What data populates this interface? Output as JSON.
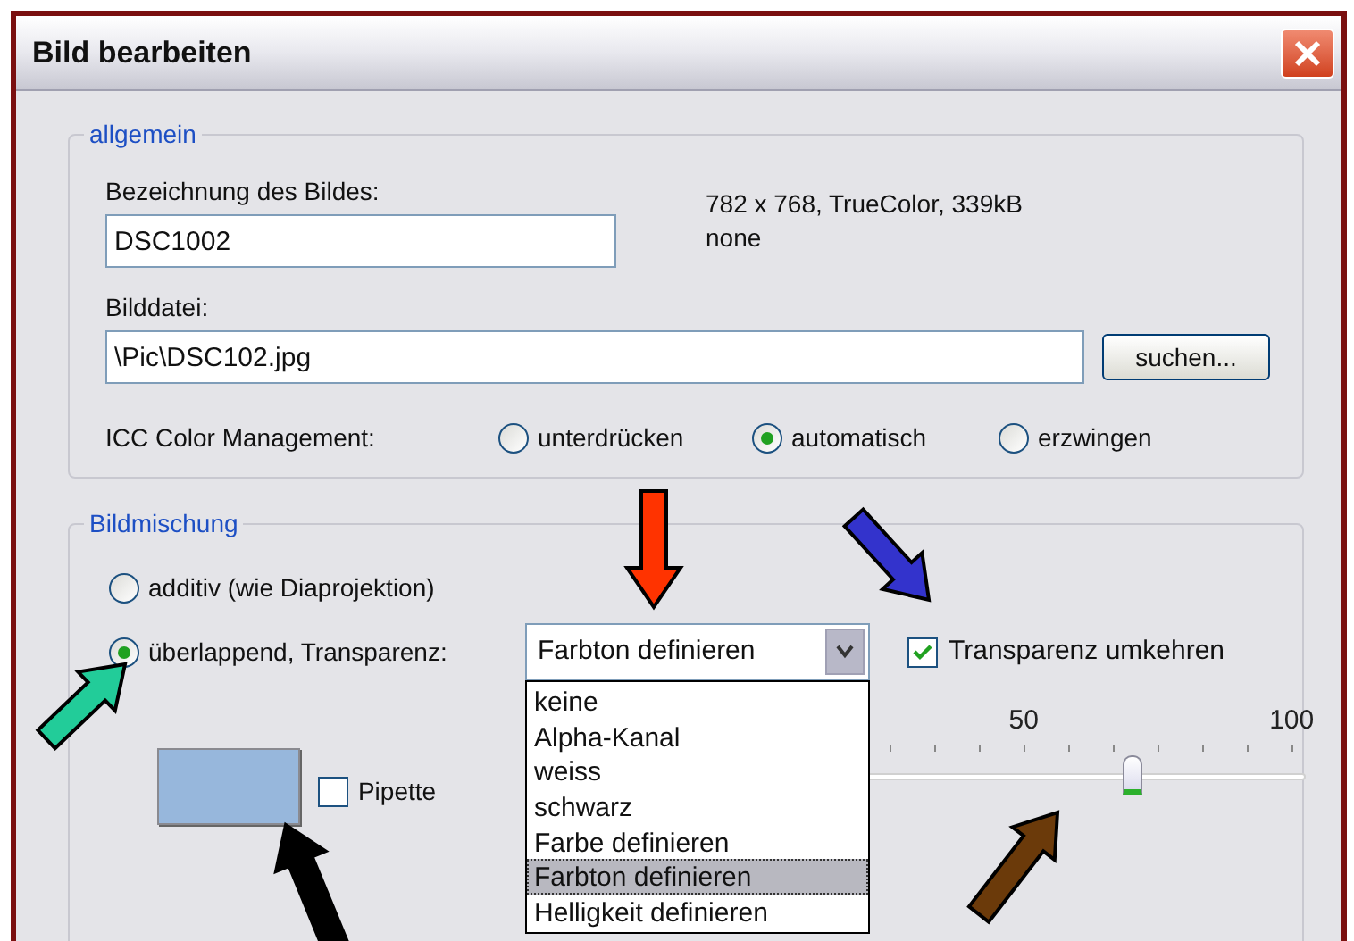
{
  "window": {
    "title": "Bild bearbeiten"
  },
  "general": {
    "legend": "allgemein",
    "name_label": "Bezeichnung des Bildes:",
    "name_value": "DSC1002",
    "info": [
      "782 x 768, TrueColor, 339kB",
      "none"
    ],
    "file_label": "Bilddatei:",
    "file_value": "\\Pic\\DSC102.jpg",
    "browse_button": "suchen...",
    "icc_label": "ICC Color Management:",
    "icc_options": [
      {
        "label": "unterdrücken",
        "selected": false
      },
      {
        "label": "automatisch",
        "selected": true
      },
      {
        "label": "erzwingen",
        "selected": false
      }
    ]
  },
  "blending": {
    "legend": "Bildmischung",
    "modes": [
      {
        "label": "additiv (wie Diaprojektion)",
        "selected": false
      },
      {
        "label": "überlappend, Transparenz:",
        "selected": true
      }
    ],
    "transparency_combo": {
      "value": "Farbton definieren",
      "expanded": true,
      "options": [
        {
          "label": "keine",
          "selected": false
        },
        {
          "label": "Alpha-Kanal",
          "selected": false
        },
        {
          "label": "weiss",
          "selected": false
        },
        {
          "label": "schwarz",
          "selected": false
        },
        {
          "label": "Farbe definieren",
          "selected": false
        },
        {
          "label": "Farbton definieren",
          "selected": true
        },
        {
          "label": "Helligkeit definieren",
          "selected": false
        }
      ]
    },
    "invert_checkbox": {
      "label": "Transparenz umkehren",
      "checked": true
    },
    "color_swatch": {
      "color": "#97b7dc"
    },
    "pipette_checkbox": {
      "label": "Pipette",
      "checked": false
    },
    "slider": {
      "tick_labels": [
        "50",
        "100"
      ],
      "level": 0.7
    }
  },
  "annotation_arrows": [
    {
      "color": "#ff3300"
    },
    {
      "color": "#3333cc"
    },
    {
      "color": "#22cc99"
    },
    {
      "color": "#000000"
    },
    {
      "color": "#6b3a0a"
    }
  ]
}
